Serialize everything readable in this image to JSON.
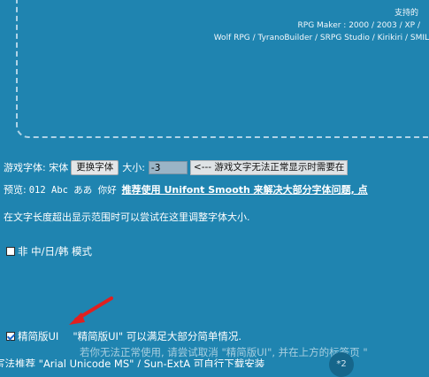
{
  "supported": {
    "title": "支持的",
    "line1": "RPG Maker : 2000 / 2003 / XP /",
    "line2": "Wolf RPG / TyranoBuilder / SRPG Studio / Kirikiri / SMIL"
  },
  "font_setting": {
    "label": "游戏字体: 宋体",
    "change_button": "更换字体",
    "size_label": "大小:",
    "size_value": "-3",
    "hint": "<--- 游戏文字无法正常显示时需要在"
  },
  "preview": {
    "label": "预览:",
    "sample": "012 Abc ああ 你好",
    "link": "推荐使用 Unifont Smooth 来解决大部分字体问题, 点"
  },
  "tip": "在文字长度超出显示范围时可以尝试在这里调整字体大小.",
  "non_cjk_mode": {
    "label": "非 中/日/韩 模式",
    "checked": false
  },
  "simple_ui": {
    "label": "精简版UI",
    "checked": true,
    "description": "\"精简版UI\" 可以满足大部分简单情况."
  },
  "overlap": {
    "line_a": "若你无法正常使用, 请尝试取消 \"精简版UI\", 并在上方的标签页 \"",
    "line_b": "写法推荐 \"Arial Unicode MS\" / Sun-ExtA 可自行下载安装"
  },
  "badge": "*2",
  "colors": {
    "background": "#1f84b0",
    "arrow": "#e02020"
  }
}
